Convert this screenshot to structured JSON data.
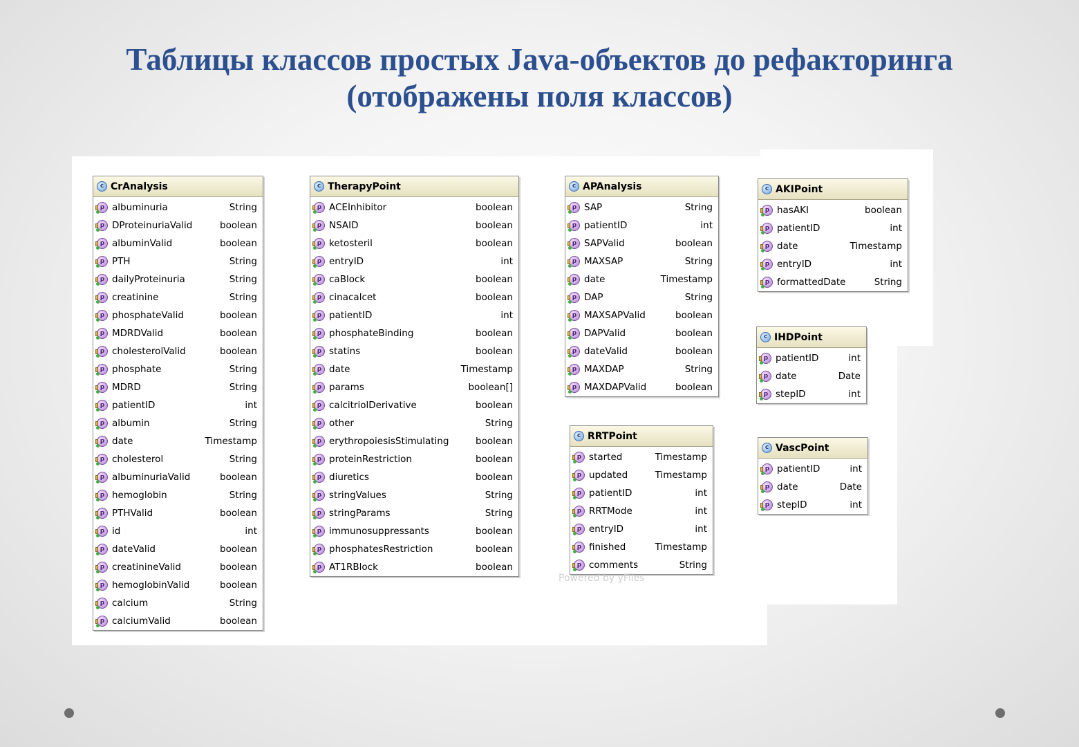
{
  "slide": {
    "title_line1": "Таблицы классов простых Java-объектов до рефакторинга",
    "title_line2": "(отображены поля классов)"
  },
  "diagram": {
    "watermark": "Powered by yFiles",
    "class_icon_letter": "c",
    "field_icon_letter": "p",
    "classes": [
      {
        "id": "cranalysis",
        "name": "CrAnalysis",
        "fields": [
          {
            "name": "albuminuria",
            "type": "String"
          },
          {
            "name": "DProteinuriaValid",
            "type": "boolean"
          },
          {
            "name": "albuminValid",
            "type": "boolean"
          },
          {
            "name": "PTH",
            "type": "String"
          },
          {
            "name": "dailyProteinuria",
            "type": "String"
          },
          {
            "name": "creatinine",
            "type": "String"
          },
          {
            "name": "phosphateValid",
            "type": "boolean"
          },
          {
            "name": "MDRDValid",
            "type": "boolean"
          },
          {
            "name": "cholesterolValid",
            "type": "boolean"
          },
          {
            "name": "phosphate",
            "type": "String"
          },
          {
            "name": "MDRD",
            "type": "String"
          },
          {
            "name": "patientID",
            "type": "int"
          },
          {
            "name": "albumin",
            "type": "String"
          },
          {
            "name": "date",
            "type": "Timestamp"
          },
          {
            "name": "cholesterol",
            "type": "String"
          },
          {
            "name": "albuminuriaValid",
            "type": "boolean"
          },
          {
            "name": "hemoglobin",
            "type": "String"
          },
          {
            "name": "PTHValid",
            "type": "boolean"
          },
          {
            "name": "id",
            "type": "int"
          },
          {
            "name": "dateValid",
            "type": "boolean"
          },
          {
            "name": "creatinineValid",
            "type": "boolean"
          },
          {
            "name": "hemoglobinValid",
            "type": "boolean"
          },
          {
            "name": "calcium",
            "type": "String"
          },
          {
            "name": "calciumValid",
            "type": "boolean"
          }
        ]
      },
      {
        "id": "therapypoint",
        "name": "TherapyPoint",
        "fields": [
          {
            "name": "ACEInhibitor",
            "type": "boolean"
          },
          {
            "name": "NSAID",
            "type": "boolean"
          },
          {
            "name": "ketosteril",
            "type": "boolean"
          },
          {
            "name": "entryID",
            "type": "int"
          },
          {
            "name": "caBlock",
            "type": "boolean"
          },
          {
            "name": "cinacalcet",
            "type": "boolean"
          },
          {
            "name": "patientID",
            "type": "int"
          },
          {
            "name": "phosphateBinding",
            "type": "boolean"
          },
          {
            "name": "statins",
            "type": "boolean"
          },
          {
            "name": "date",
            "type": "Timestamp"
          },
          {
            "name": "params",
            "type": "boolean[]"
          },
          {
            "name": "calcitriolDerivative",
            "type": "boolean"
          },
          {
            "name": "other",
            "type": "String"
          },
          {
            "name": "erythropoiesisStimulating",
            "type": "boolean"
          },
          {
            "name": "proteinRestriction",
            "type": "boolean"
          },
          {
            "name": "diuretics",
            "type": "boolean"
          },
          {
            "name": "stringValues",
            "type": "String"
          },
          {
            "name": "stringParams",
            "type": "String"
          },
          {
            "name": "immunosuppressants",
            "type": "boolean"
          },
          {
            "name": "phosphatesRestriction",
            "type": "boolean"
          },
          {
            "name": "AT1RBlock",
            "type": "boolean"
          }
        ]
      },
      {
        "id": "apanalysis",
        "name": "APAnalysis",
        "fields": [
          {
            "name": "SAP",
            "type": "String"
          },
          {
            "name": "patientID",
            "type": "int"
          },
          {
            "name": "SAPValid",
            "type": "boolean"
          },
          {
            "name": "MAXSAP",
            "type": "String"
          },
          {
            "name": "date",
            "type": "Timestamp"
          },
          {
            "name": "DAP",
            "type": "String"
          },
          {
            "name": "MAXSAPValid",
            "type": "boolean"
          },
          {
            "name": "DAPValid",
            "type": "boolean"
          },
          {
            "name": "dateValid",
            "type": "boolean"
          },
          {
            "name": "MAXDAP",
            "type": "String"
          },
          {
            "name": "MAXDAPValid",
            "type": "boolean"
          }
        ]
      },
      {
        "id": "akipoint",
        "name": "AKIPoint",
        "fields": [
          {
            "name": "hasAKI",
            "type": "boolean"
          },
          {
            "name": "patientID",
            "type": "int"
          },
          {
            "name": "date",
            "type": "Timestamp"
          },
          {
            "name": "entryID",
            "type": "int"
          },
          {
            "name": "formattedDate",
            "type": "String"
          }
        ]
      },
      {
        "id": "ihdpoint",
        "name": "IHDPoint",
        "fields": [
          {
            "name": "patientID",
            "type": "int"
          },
          {
            "name": "date",
            "type": "Date"
          },
          {
            "name": "stepID",
            "type": "int"
          }
        ]
      },
      {
        "id": "rrtpoint",
        "name": "RRTPoint",
        "fields": [
          {
            "name": "started",
            "type": "Timestamp"
          },
          {
            "name": "updated",
            "type": "Timestamp"
          },
          {
            "name": "patientID",
            "type": "int"
          },
          {
            "name": "RRTMode",
            "type": "int"
          },
          {
            "name": "entryID",
            "type": "int"
          },
          {
            "name": "finished",
            "type": "Timestamp"
          },
          {
            "name": "comments",
            "type": "String"
          }
        ]
      },
      {
        "id": "vascpoint",
        "name": "VascPoint",
        "fields": [
          {
            "name": "patientID",
            "type": "int"
          },
          {
            "name": "date",
            "type": "Date"
          },
          {
            "name": "stepID",
            "type": "int"
          }
        ]
      }
    ]
  }
}
